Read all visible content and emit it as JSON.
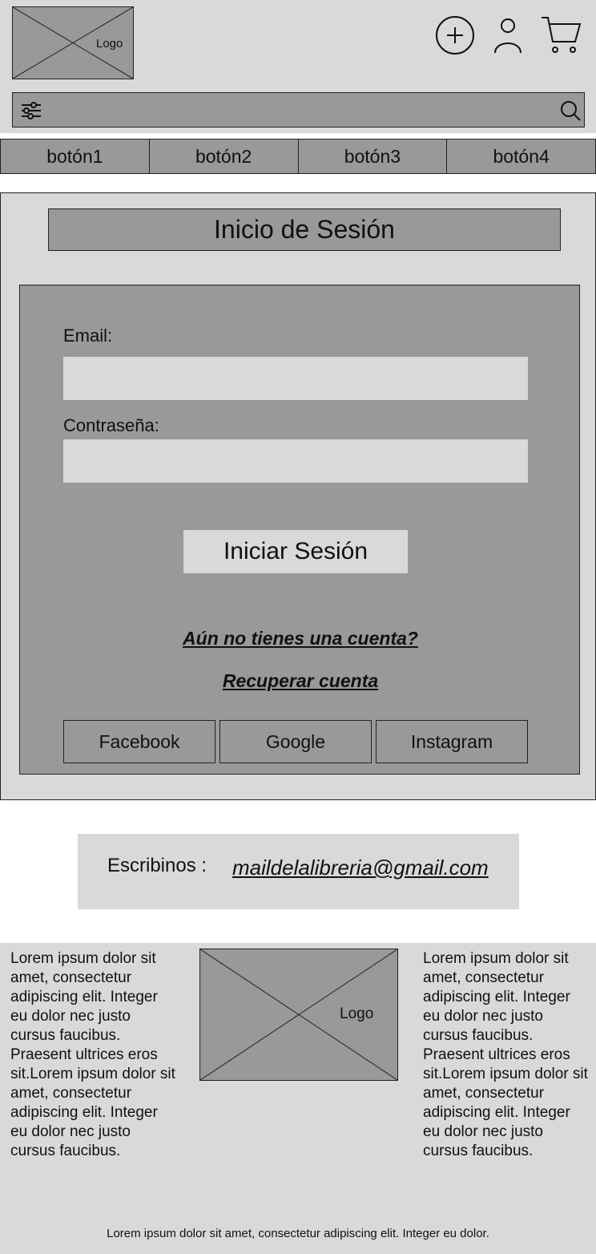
{
  "header": {
    "logo_label": "Logo",
    "icons": [
      "plus-circle-icon",
      "user-icon",
      "cart-icon"
    ],
    "search_placeholder": ""
  },
  "nav": {
    "buttons": [
      "botón1",
      "botón2",
      "botón3",
      "botón4"
    ]
  },
  "login": {
    "title": "Inicio de Sesión",
    "email_label": "Email:",
    "password_label": "Contraseña:",
    "email_value": "",
    "password_value": "",
    "submit_label": "Iniciar Sesión",
    "no_account_link": "Aún no tienes una cuenta?",
    "recover_link": "Recuperar cuenta",
    "social": [
      "Facebook",
      "Google",
      "Instagram"
    ]
  },
  "contact": {
    "label": "Escribinos :",
    "email": "maildelalibreria@gmail.com"
  },
  "footer": {
    "left_text": "Lorem ipsum dolor sit amet, consectetur adipiscing elit. Integer eu dolor nec justo cursus faucibus. Praesent ultrices eros sit.Lorem ipsum dolor sit amet, consectetur adipiscing elit. Integer eu dolor nec justo cursus faucibus.",
    "right_text": "Lorem ipsum dolor sit amet, consectetur adipiscing elit. Integer eu dolor nec justo cursus faucibus. Praesent ultrices eros sit.Lorem ipsum dolor sit amet, consectetur adipiscing elit. Integer eu dolor nec justo cursus faucibus.",
    "logo_label": "Logo",
    "bottom_text": "Lorem ipsum dolor sit amet, consectetur adipiscing elit. Integer eu dolor."
  },
  "colors": {
    "panel": "#d9d9d9",
    "box": "#9a9898",
    "border": "#222222"
  }
}
